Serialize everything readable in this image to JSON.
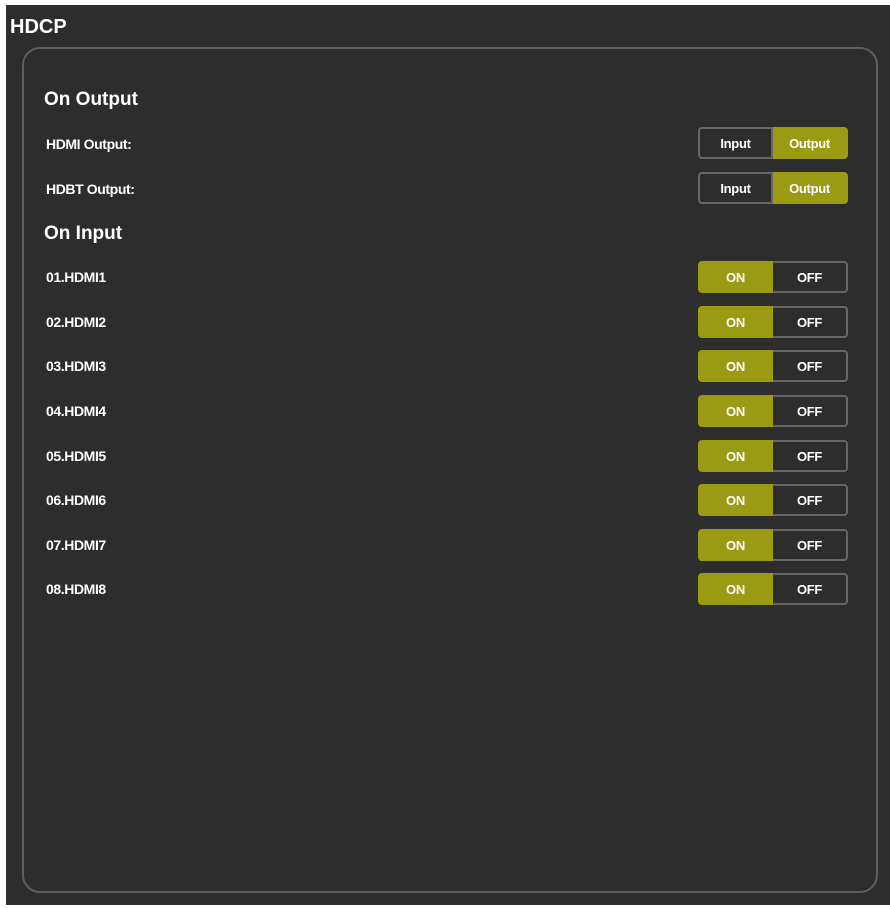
{
  "page_title": "HDCP",
  "colors": {
    "background": "#2d2d2d",
    "panel_border": "#5e5e5e",
    "active": "#9b9a13",
    "text": "#ffffff"
  },
  "output_section": {
    "title": "On Output",
    "rows": [
      {
        "label": "HDMI Output:",
        "options": [
          "Input",
          "Output"
        ],
        "selected": "Output"
      },
      {
        "label": "HDBT Output:",
        "options": [
          "Input",
          "Output"
        ],
        "selected": "Output"
      }
    ]
  },
  "input_section": {
    "title": "On Input",
    "rows": [
      {
        "label": "01.HDMI1",
        "on": "ON",
        "off": "OFF",
        "state": "ON"
      },
      {
        "label": "02.HDMI2",
        "on": "ON",
        "off": "OFF",
        "state": "ON"
      },
      {
        "label": "03.HDMI3",
        "on": "ON",
        "off": "OFF",
        "state": "ON"
      },
      {
        "label": "04.HDMI4",
        "on": "ON",
        "off": "OFF",
        "state": "ON"
      },
      {
        "label": "05.HDMI5",
        "on": "ON",
        "off": "OFF",
        "state": "ON"
      },
      {
        "label": "06.HDMI6",
        "on": "ON",
        "off": "OFF",
        "state": "ON"
      },
      {
        "label": "07.HDMI7",
        "on": "ON",
        "off": "OFF",
        "state": "ON"
      },
      {
        "label": "08.HDMI8",
        "on": "ON",
        "off": "OFF",
        "state": "ON"
      }
    ]
  }
}
